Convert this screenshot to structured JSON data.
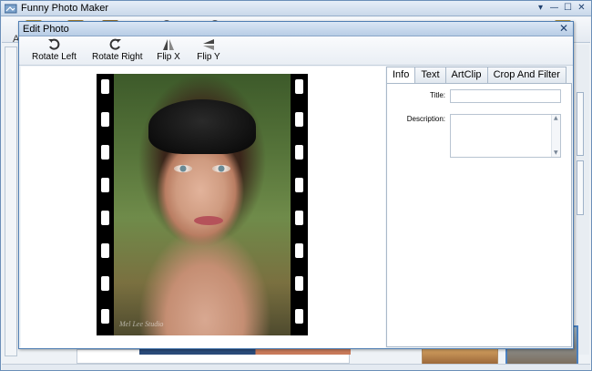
{
  "app": {
    "title": "Funny Photo Maker",
    "toolbar_hint": "A",
    "window_buttons": [
      "▾",
      "—",
      "☐",
      "✕"
    ]
  },
  "dialog": {
    "title": "Edit Photo",
    "close_glyph": "✕",
    "toolbar": [
      {
        "label": "Rotate Left",
        "icon": "rotate-left-icon"
      },
      {
        "label": "Rotate Right",
        "icon": "rotate-right-icon"
      },
      {
        "label": "Flip X",
        "icon": "flip-horizontal-icon"
      },
      {
        "label": "Flip Y",
        "icon": "flip-vertical-icon"
      }
    ],
    "photo": {
      "watermark": "Mel Lee Studio"
    },
    "tabs": [
      {
        "label": "Info",
        "active": true
      },
      {
        "label": "Text",
        "active": false
      },
      {
        "label": "ArtClip",
        "active": false
      },
      {
        "label": "Crop And Filter",
        "active": false
      }
    ],
    "info": {
      "title_label": "Title:",
      "title_value": "",
      "description_label": "Description:",
      "description_value": ""
    }
  },
  "colors": {
    "title_bar": "#c9d8ea",
    "dialog_border": "#4f7eb3",
    "canvas_bg": "#ffffff"
  }
}
